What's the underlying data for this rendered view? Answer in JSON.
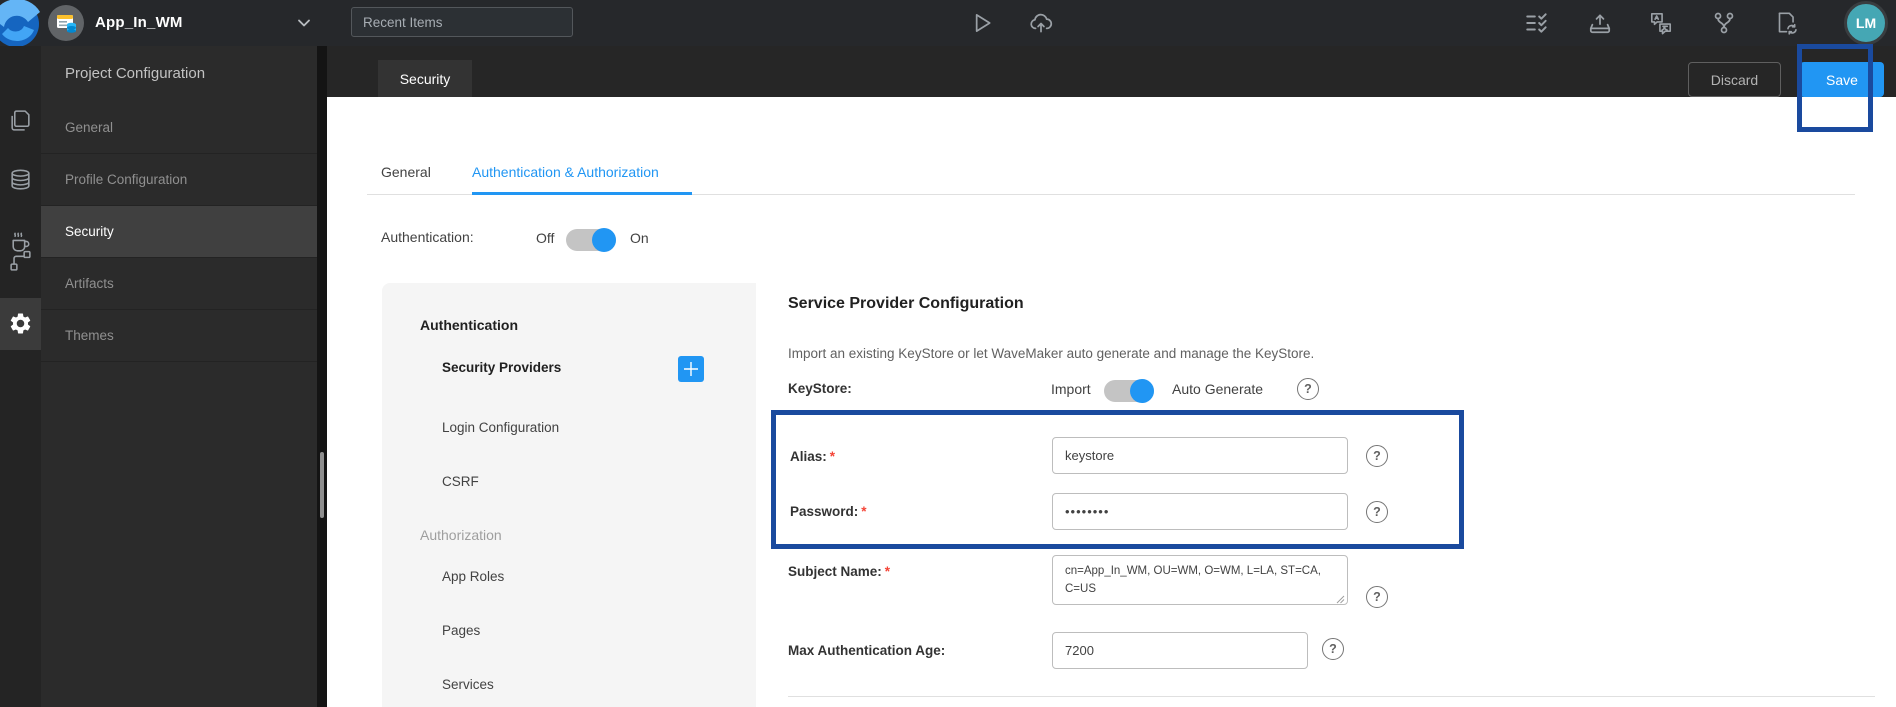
{
  "topbar": {
    "app_name": "App_In_WM",
    "recent_items_placeholder": "Recent Items",
    "avatar_initials": "LM"
  },
  "sidebar": {
    "title": "Project Configuration",
    "items": [
      {
        "label": "General"
      },
      {
        "label": "Profile Configuration"
      },
      {
        "label": "Security",
        "active": true
      },
      {
        "label": "Artifacts"
      },
      {
        "label": "Themes"
      }
    ]
  },
  "header": {
    "page_tab": "Security",
    "discard_label": "Discard",
    "save_label": "Save"
  },
  "tabs": [
    {
      "label": "General"
    },
    {
      "label": "Authentication & Authorization",
      "active": true
    }
  ],
  "auth_row": {
    "label": "Authentication:",
    "off_label": "Off",
    "on_label": "On",
    "state": "on"
  },
  "subnav": {
    "section1": "Authentication",
    "items": [
      "Security Providers",
      "Login Configuration",
      "CSRF",
      "App Roles",
      "Pages",
      "Services"
    ],
    "section2": "Authorization",
    "active_item": "Security Providers"
  },
  "form": {
    "heading": "Service Provider Configuration",
    "description": "Import an existing KeyStore or let WaveMaker auto generate and manage the KeyStore.",
    "keystore": {
      "label": "KeyStore:",
      "off_label": "Import",
      "on_label": "Auto Generate",
      "state": "on"
    },
    "fields": {
      "alias": {
        "label": "Alias:",
        "required": "*",
        "value": "keystore"
      },
      "password": {
        "label": "Password:",
        "required": "*",
        "value": "••••••••"
      },
      "subject": {
        "label": "Subject Name:",
        "required": "*",
        "value": "cn=App_In_WM, OU=WM, O=WM, L=LA, ST=CA, C=US"
      },
      "max_age": {
        "label": "Max Authentication Age:",
        "value": "7200"
      }
    }
  },
  "icons": {
    "help_glyph": "?"
  },
  "colors": {
    "accent": "#2196f3",
    "annotation_box": "#1a4a9e",
    "avatar_bg": "#45a7b4",
    "topbar_bg": "#26282b"
  }
}
